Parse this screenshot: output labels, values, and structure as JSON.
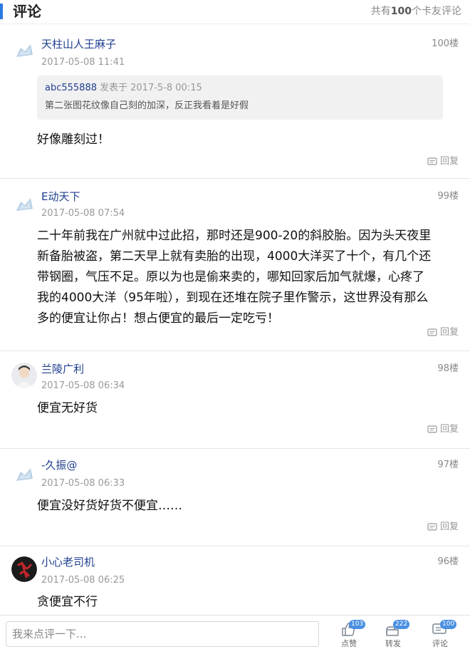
{
  "header": {
    "title": "评论",
    "count_prefix": "共有",
    "count_value": "100",
    "count_suffix": "个卡友评论"
  },
  "reply_label": "回复",
  "comments": [
    {
      "username": "天柱山人王麻子",
      "floor": "100楼",
      "time": "2017-05-08 11:41",
      "avatar": "default-cloud-avatar",
      "quote": {
        "name": "abc555888",
        "meta": "发表于 2017-5-8 00:15",
        "text": "第二张图花纹像自己刻的加深，反正我看着是好假"
      },
      "lines": [
        "好像雕刻过！"
      ]
    },
    {
      "username": "E动天下",
      "floor": "99楼",
      "time": "2017-05-08 07:54",
      "avatar": "default-cloud-avatar",
      "lines": [
        "二十年前我在广州就中过此招，那时还是900-20的斜胶胎。因为头天夜里",
        "新备胎被盗，第二天早上就有卖胎的出现，4000大洋买了十个，有几个还",
        "带钢圈，气压不足。原以为也是偷来卖的，哪知回家后加气就爆，心疼了",
        "我的4000大洋（95年啦），到现在还堆在院子里作警示，这世界没有那么",
        "多的便宜让你占！想占便宜的最后一定吃亏！"
      ]
    },
    {
      "username": "兰陵广利",
      "floor": "98楼",
      "time": "2017-05-08 06:34",
      "avatar": "person-photo-avatar",
      "lines": [
        "便宜无好货"
      ]
    },
    {
      "username": "-久振@",
      "floor": "97楼",
      "time": "2017-05-08 06:33",
      "avatar": "default-cloud-avatar",
      "lines": [
        "便宜没好货好货不便宜……"
      ]
    },
    {
      "username": "小心老司机",
      "floor": "96楼",
      "time": "2017-05-08 06:25",
      "avatar": "red-calligraphy-avatar",
      "lines": [
        "贪便宜不行"
      ]
    }
  ],
  "bottombar": {
    "input_placeholder": "我来点评一下...",
    "actions": [
      {
        "label": "点赞",
        "badge": "103",
        "icon": "thumbs-up-icon"
      },
      {
        "label": "转发",
        "badge": "222",
        "icon": "share-icon"
      },
      {
        "label": "评论",
        "badge": "100",
        "icon": "comment-icon"
      }
    ]
  },
  "colors": {
    "accent": "#2a7ae2",
    "username": "#1f3f8f",
    "badge": "#4a90e2",
    "muted": "#999999"
  }
}
